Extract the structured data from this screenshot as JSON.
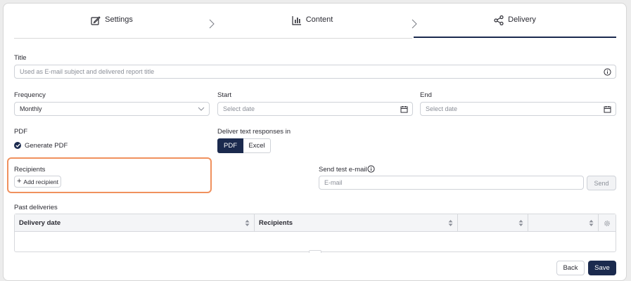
{
  "tabs": [
    {
      "label": "Settings",
      "icon": "edit-icon"
    },
    {
      "label": "Content",
      "icon": "bar-chart-icon"
    },
    {
      "label": "Delivery",
      "icon": "share-icon",
      "active": true
    }
  ],
  "title_section": {
    "label": "Title",
    "placeholder": "Used as E-mail subject and delivered report title"
  },
  "frequency": {
    "label": "Frequency",
    "value": "Monthly"
  },
  "start": {
    "label": "Start",
    "placeholder": "Select date"
  },
  "end": {
    "label": "End",
    "placeholder": "Select date"
  },
  "pdf": {
    "label": "PDF",
    "checkbox_label": "Generate PDF",
    "checked": true
  },
  "text_responses": {
    "label": "Deliver text responses in",
    "options": [
      "PDF",
      "Excel"
    ],
    "selected": "PDF"
  },
  "recipients": {
    "label": "Recipients",
    "add_button": "Add recipient"
  },
  "test_email": {
    "label": "Send test e-mail",
    "placeholder": "E-mail",
    "send_button": "Send"
  },
  "past_deliveries": {
    "label": "Past deliveries",
    "columns": [
      "Delivery date",
      "Recipients",
      "",
      ""
    ]
  },
  "footer": {
    "back": "Back",
    "save": "Save"
  },
  "colors": {
    "primary": "#1b2a4e",
    "highlight": "#f0915e",
    "border": "#cfd2d8"
  }
}
